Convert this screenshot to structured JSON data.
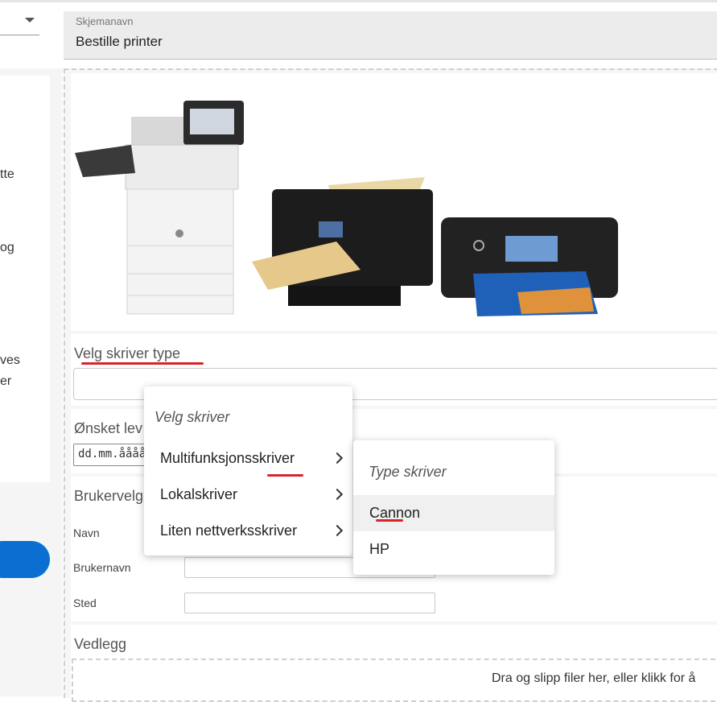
{
  "left": {
    "fragments": [
      "tte",
      "og",
      "ves",
      "er"
    ]
  },
  "schema": {
    "label": "Skjemanavn",
    "value": "Bestille printer"
  },
  "form": {
    "printer_type_title": "Velg skriver type",
    "delivery_title": "Ønsket lev",
    "date_value": "dd.mm.åååå",
    "user_section_title": "Brukervelg",
    "name_label": "Navn",
    "username_label": "Brukernavn",
    "location_label": "Sted",
    "attachments_title": "Vedlegg",
    "dropzone_text": "Dra og slipp filer her, eller klikk for å"
  },
  "menu_primary": {
    "header": "Velg skriver",
    "items": [
      "Multifunksjonsskriver",
      "Lokalskriver",
      "Liten nettverksskriver"
    ]
  },
  "menu_sub": {
    "header": "Type skriver",
    "items": [
      "Cannon",
      "HP"
    ]
  },
  "colors": {
    "accent_blue": "#0a6fd0",
    "annotation_red": "#d9242b"
  }
}
